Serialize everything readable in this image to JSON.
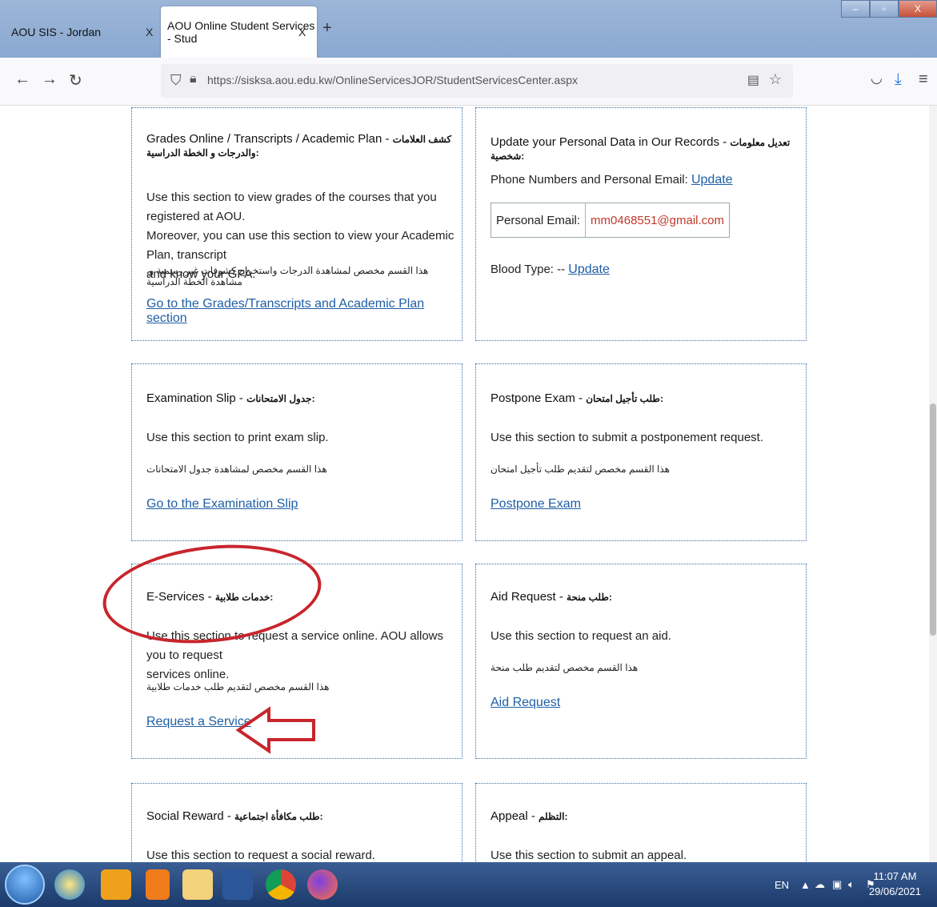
{
  "browser": {
    "tabs": [
      {
        "label": "AOU SIS - Jordan",
        "close": "X"
      },
      {
        "label": "AOU Online Student Services - Stud",
        "close": "X"
      }
    ],
    "new_tab": "+",
    "window_buttons": {
      "minimize": "–",
      "maximize": "▫",
      "close": "X"
    },
    "url": "https://sisksa.aou.edu.kw/OnlineServicesJOR/StudentServicesCenter.aspx"
  },
  "cards": {
    "grades": {
      "title": "Grades Online / Transcripts / Academic Plan - ",
      "title_ar": "كشف العلامات والدرجات و الخطة الدراسية:",
      "desc_lines": [
        "Use this section to view grades of the courses that you registered at AOU.",
        "Moreover, you can use this section to view your Academic Plan, transcript",
        "and know your GPA."
      ],
      "desc_ar": ".هذا القسم مخصص لمشاهدة الدرجات واستخراج كشوفات غير رسمية و مشاهدة الخطة الدراسية",
      "link": "Go to the Grades/Transcripts and Academic Plan section"
    },
    "personal": {
      "title": "Update your Personal Data in Our Records - ",
      "title_ar": "تعديل معلومات شخصية:",
      "phone_label": "Phone Numbers and Personal Email: ",
      "phone_link": "Update",
      "email_label": "Personal Email:",
      "email_value": "mm0468551@gmail.com",
      "blood_label": "Blood Type: -- ",
      "blood_link": "Update"
    },
    "exam_slip": {
      "title": "Examination Slip - ",
      "title_ar": "جدول الامتحانات:",
      "desc": "Use this section to print exam slip.",
      "desc_ar": "هذا القسم مخصص لمشاهدة جدول الامتحانات",
      "link": "Go to the Examination Slip"
    },
    "postpone": {
      "title": "Postpone Exam - ",
      "title_ar": "طلب تأجيل امتحان:",
      "desc": "Use this section to submit a postponement request.",
      "desc_ar": "هذا القسم مخصص لتقديم طلب تأجيل امتحان",
      "link": "Postpone Exam"
    },
    "eservices": {
      "title": "E-Services - ",
      "title_ar": "خدمات طلابية:",
      "desc_lines": [
        "Use this section to request a service online. AOU allows you to request",
        "services online."
      ],
      "desc_ar": "هذا القسم مخصص لتقديم طلب خدمات طلابية",
      "link": "Request a Service"
    },
    "aid": {
      "title": "Aid Request - ",
      "title_ar": "طلب منحة:",
      "desc": "Use this section to request an aid.",
      "desc_ar": "هذا القسم مخصص لتقديم طلب منحة",
      "link": "Aid Request"
    },
    "social": {
      "title": "Social Reward - ",
      "title_ar": "طلب مكافأة اجتماعية:",
      "desc": "Use this section to request a social reward."
    },
    "appeal": {
      "title": "Appeal - ",
      "title_ar": "التظلم:",
      "desc": "Use this section to submit an appeal."
    }
  },
  "taskbar": {
    "lang": "EN",
    "time": "11:07 AM",
    "date": "29/06/2021"
  },
  "colors": {
    "link": "#1f5fa6",
    "annotation": "#c8252c",
    "email": "#c0392b"
  }
}
